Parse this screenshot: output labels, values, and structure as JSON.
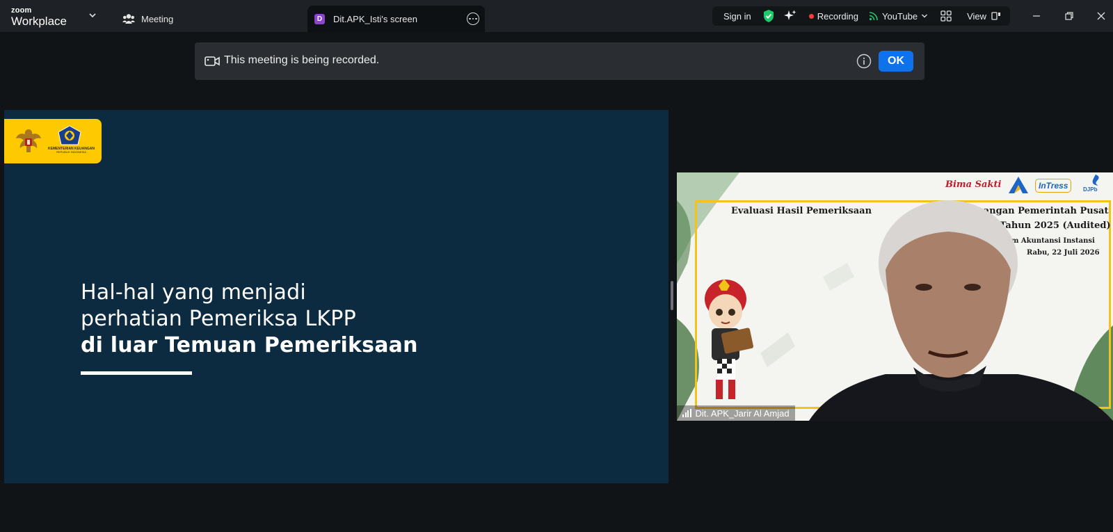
{
  "app": {
    "brand_top": "zoom",
    "brand_bottom": "Workplace"
  },
  "tabs": [
    {
      "label": "Meeting",
      "icon": "meeting-icon"
    },
    {
      "label": "Dit.APK_Isti's screen",
      "badge": "D",
      "badge_color": "#8b45c9"
    }
  ],
  "toolbar": {
    "sign_in": "Sign in",
    "recording": "Recording",
    "youtube": "YouTube",
    "view": "View"
  },
  "notice": {
    "text": "This meeting is being recorded.",
    "ok_label": "OK",
    "accent": "#0e72ed"
  },
  "slide": {
    "logo_org": "KEMENTERIAN KEUANGAN",
    "logo_sub": "REPUBLIK INDONESIA",
    "line1": "Hal-hal yang menjadi",
    "line2": "perhatian Pemeriksa LKPP",
    "line3": "di luar Temuan Pemeriksaan",
    "background": "#0d2b40",
    "logo_bg": "#ffc900"
  },
  "video": {
    "brand_bima": "Bima Sakti",
    "brand_intress": "InTress",
    "brand_djpb": "DJPb",
    "title_left": "Evaluasi Hasil Pemeriksaan",
    "title_right": "Keuangan Pemerintah Pusat",
    "title_line2": "Tahun 2025 (Audited)",
    "subtitle": "an Sistem Akuntansi Instansi",
    "date": "Rabu, 22 Juli 2026",
    "participant": "Dit. APK_Jarir Al Amjad"
  }
}
